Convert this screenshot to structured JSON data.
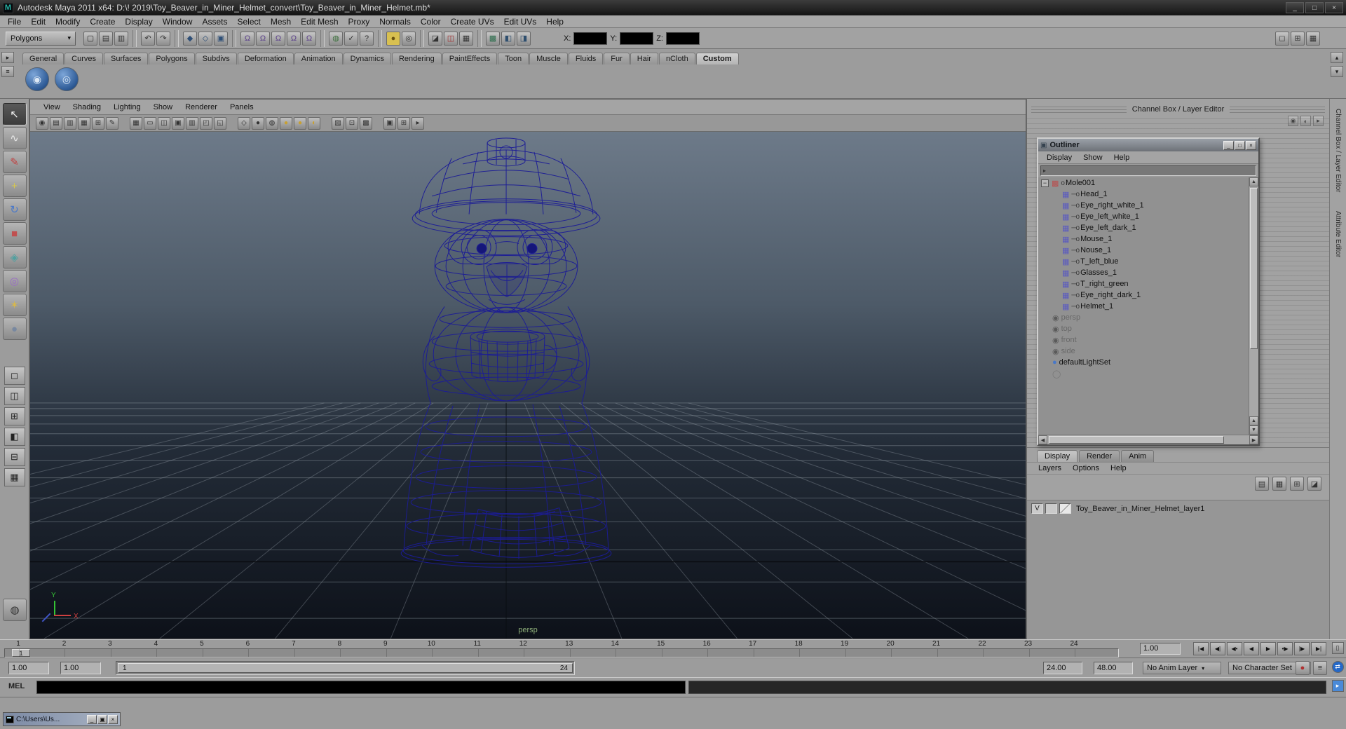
{
  "titlebar": {
    "icon_glyph": "M",
    "title": "Autodesk Maya 2011 x64: D:\\! 2019\\Toy_Beaver_in_Miner_Helmet_convert\\Toy_Beaver_in_Miner_Helmet.mb*",
    "buttons": [
      {
        "n": "minimize",
        "g": "_"
      },
      {
        "n": "maximize",
        "g": "□"
      },
      {
        "n": "close",
        "g": "×"
      }
    ]
  },
  "menubar": {
    "items": [
      "File",
      "Edit",
      "Modify",
      "Create",
      "Display",
      "Window",
      "Assets",
      "Select",
      "Mesh",
      "Edit Mesh",
      "Proxy",
      "Normals",
      "Color",
      "Create UVs",
      "Edit UVs",
      "Help"
    ]
  },
  "statusline": {
    "mode_dropdown": "Polygons",
    "icon_groups": [
      {
        "icons": [
          {
            "n": "new-scene",
            "g": "▢"
          },
          {
            "n": "open-scene",
            "g": "▤"
          },
          {
            "n": "save-scene",
            "g": "▥"
          }
        ]
      },
      {
        "icons": [
          {
            "n": "undo",
            "g": "↶"
          },
          {
            "n": "redo",
            "g": "↷"
          }
        ]
      },
      {
        "icons": [
          {
            "n": "select-hierarchy",
            "g": "◆",
            "c": "#2e4f77"
          },
          {
            "n": "select-object",
            "g": "◇",
            "c": "#2e4f77"
          },
          {
            "n": "select-component",
            "g": "▣",
            "c": "#2e4f77"
          }
        ]
      },
      {
        "icons": [
          {
            "n": "snap-to-grid",
            "g": "Ω",
            "c": "#5a3f8a"
          },
          {
            "n": "snap-to-curve",
            "g": "Ω",
            "c": "#5a3f8a"
          },
          {
            "n": "snap-to-point",
            "g": "Ω",
            "c": "#5a3f8a"
          },
          {
            "n": "snap-to-plane",
            "g": "Ω",
            "c": "#5a3f8a"
          },
          {
            "n": "snap-to-view",
            "g": "Ω",
            "c": "#5a3f8a"
          }
        ]
      },
      {
        "icons": [
          {
            "n": "make-live",
            "g": "◍",
            "c": "#3a6f3a"
          },
          {
            "n": "construction-history",
            "g": "✓",
            "c": "#333333"
          },
          {
            "n": "help-line",
            "g": "?",
            "c": "#333333"
          }
        ]
      },
      {
        "icons": [
          {
            "n": "lock-selection",
            "g": "●",
            "c": "#6a5210",
            "bg": "#d8c050"
          },
          {
            "n": "highlight-selection",
            "g": "◎",
            "c": "#333333"
          }
        ]
      },
      {
        "icons": [
          {
            "n": "render-view",
            "g": "◪",
            "c": "#333333"
          },
          {
            "n": "ipr-render",
            "g": "◫",
            "c": "#a03030"
          },
          {
            "n": "render-settings",
            "g": "▦",
            "c": "#333333"
          }
        ]
      },
      {
        "icons": [
          {
            "n": "texture-view",
            "g": "▩",
            "c": "#2e6e4e"
          },
          {
            "n": "hypershade",
            "g": "◧",
            "c": "#2e4e6e"
          },
          {
            "n": "hypergraph",
            "g": "◨",
            "c": "#2e4e6e"
          }
        ]
      }
    ],
    "coords": {
      "x_label": "X:",
      "y_label": "Y:",
      "z_label": "Z:",
      "x_value": "",
      "y_value": "",
      "z_value": ""
    },
    "layout_icons": [
      {
        "n": "single-pane-layout",
        "g": "◻"
      },
      {
        "n": "four-pane-layout",
        "g": "⊞"
      },
      {
        "n": "saved-layouts",
        "g": "▦"
      }
    ]
  },
  "shelf": {
    "tabs": [
      "General",
      "Curves",
      "Surfaces",
      "Polygons",
      "Subdivs",
      "Deformation",
      "Animation",
      "Dynamics",
      "Rendering",
      "PaintEffects",
      "Toon",
      "Muscle",
      "Fluids",
      "Fur",
      "Hair",
      "nCloth",
      "Custom"
    ],
    "active_tab": "Custom",
    "items": [
      {
        "n": "custom-shelf-item-1",
        "g": "◉"
      },
      {
        "n": "custom-shelf-item-2",
        "g": "◎"
      }
    ],
    "side_buttons": [
      {
        "n": "shelf-tab-menu",
        "g": "▸"
      },
      {
        "n": "shelf-options-menu",
        "g": "≡"
      }
    ],
    "right_buttons": [
      {
        "n": "shelf-scroll-up",
        "g": "▴"
      },
      {
        "n": "shelf-scroll-down",
        "g": "▾"
      }
    ]
  },
  "toolbox": {
    "tools": [
      {
        "n": "select-tool",
        "g": "↖",
        "c": "#f5f5f5",
        "active": true
      },
      {
        "n": "lasso-select-tool",
        "g": "∿",
        "c": "#e8e8e8"
      },
      {
        "n": "paint-select-tool",
        "g": "✎",
        "c": "#c04040"
      },
      {
        "n": "move-tool",
        "g": "+",
        "c": "#d8c84a"
      },
      {
        "n": "rotate-tool",
        "g": "↻",
        "c": "#4a78c8"
      },
      {
        "n": "scale-tool",
        "g": "■",
        "c": "#c05050"
      },
      {
        "n": "universal-manipulator-tool",
        "g": "◈",
        "c": "#50a0a0"
      },
      {
        "n": "soft-modification-tool",
        "g": "◎",
        "c": "#9a6ac8"
      },
      {
        "n": "show-manipulator-tool",
        "g": "✶",
        "c": "#d8b84a"
      },
      {
        "n": "last-tool",
        "g": "●",
        "c": "#7888a0"
      }
    ],
    "layouts": [
      {
        "n": "single-pane",
        "g": "◻"
      },
      {
        "n": "two-pane-side-by-side",
        "g": "◫"
      },
      {
        "n": "four-pane",
        "g": "⊞"
      },
      {
        "n": "three-pane-left",
        "g": "◧"
      },
      {
        "n": "two-pane-stacked",
        "g": "⊟"
      },
      {
        "n": "multi-pane",
        "g": "▦"
      }
    ],
    "extra": {
      "n": "toolbox-extra",
      "g": "◍"
    }
  },
  "viewport": {
    "menus": [
      "View",
      "Shading",
      "Lighting",
      "Show",
      "Renderer",
      "Panels"
    ],
    "toolbar": [
      {
        "n": "camera-select",
        "g": "◉"
      },
      {
        "n": "camera-attributes",
        "g": "▤"
      },
      {
        "n": "bookmarks",
        "g": "▥"
      },
      {
        "n": "image-plane",
        "g": "▦"
      },
      {
        "n": "2d-pan-zoom",
        "g": "⊞"
      },
      {
        "n": "grease-pencil",
        "g": "✎"
      },
      {
        "n": "gap"
      },
      {
        "n": "grid-toggle",
        "g": "▦"
      },
      {
        "n": "film-gate",
        "g": "▭"
      },
      {
        "n": "resolution-gate",
        "g": "◫"
      },
      {
        "n": "gate-mask",
        "g": "▣"
      },
      {
        "n": "field-chart",
        "g": "▥"
      },
      {
        "n": "safe-action",
        "g": "◰"
      },
      {
        "n": "safe-title",
        "g": "◱"
      },
      {
        "n": "gap"
      },
      {
        "n": "wireframe-display",
        "g": "◇"
      },
      {
        "n": "shaded-display",
        "g": "●"
      },
      {
        "n": "textured-display",
        "g": "◍"
      },
      {
        "n": "default-lighting",
        "g": "●",
        "c": "#c8a030"
      },
      {
        "n": "all-lights",
        "g": "●",
        "c": "#c8a030"
      },
      {
        "n": "shadows-toggle",
        "g": "◐",
        "c": "#c8a030"
      },
      {
        "n": "gap"
      },
      {
        "n": "xray-display",
        "g": "▨"
      },
      {
        "n": "isolate-select",
        "g": "⊡"
      },
      {
        "n": "multisample",
        "g": "▩"
      },
      {
        "n": "gap"
      },
      {
        "n": "tear-off-panel",
        "g": "▣"
      },
      {
        "n": "panel-config",
        "g": "⊞"
      },
      {
        "n": "share-view",
        "g": "▸"
      }
    ],
    "camera_label": "persp",
    "axis_y": "Y",
    "axis_x": "X"
  },
  "rightpanel": {
    "header": "Channel Box / Layer Editor",
    "top_icons": [
      {
        "n": "manipulator-sync",
        "g": "◉"
      },
      {
        "n": "speed-toggle",
        "g": "◐"
      },
      {
        "n": "channel-expand",
        "g": "▸"
      }
    ]
  },
  "outliner": {
    "title": "Outliner",
    "window_buttons": [
      {
        "n": "minimize",
        "g": "_"
      },
      {
        "n": "maximize",
        "g": "□"
      },
      {
        "n": "close",
        "g": "×"
      }
    ],
    "menus": [
      "Display",
      "Show",
      "Help"
    ],
    "icon_types": {
      "mesh": {
        "glyph": "▦",
        "color": "#5a5ac0"
      },
      "reference": {
        "glyph": "▩",
        "color": "#b85050"
      },
      "camera": {
        "glyph": "◉",
        "color": "#5a5a5a"
      },
      "lightset": {
        "glyph": "●",
        "color": "#4878c8"
      },
      "set": {
        "glyph": "◯",
        "color": "#777777"
      }
    },
    "items": [
      {
        "label": "Mole001",
        "icon": "reference",
        "expander": true,
        "connector": "o",
        "indent": 0
      },
      {
        "label": "Head_1",
        "icon": "mesh",
        "connector": "─o",
        "indent": 1
      },
      {
        "label": "Eye_right_white_1",
        "icon": "mesh",
        "connector": "─o",
        "indent": 1
      },
      {
        "label": "Eye_left_white_1",
        "icon": "mesh",
        "connector": "─o",
        "indent": 1
      },
      {
        "label": "Eye_left_dark_1",
        "icon": "mesh",
        "connector": "─o",
        "indent": 1
      },
      {
        "label": "Mouse_1",
        "icon": "mesh",
        "connector": "─o",
        "indent": 1
      },
      {
        "label": "Nouse_1",
        "icon": "mesh",
        "connector": "─o",
        "indent": 1
      },
      {
        "label": "T_left_blue",
        "icon": "mesh",
        "connector": "─o",
        "indent": 1
      },
      {
        "label": "Glasses_1",
        "icon": "mesh",
        "connector": "─o",
        "indent": 1
      },
      {
        "label": "T_right_green",
        "icon": "mesh",
        "connector": "─o",
        "indent": 1
      },
      {
        "label": "Eye_right_dark_1",
        "icon": "mesh",
        "connector": "─o",
        "indent": 1
      },
      {
        "label": "Helmet_1",
        "icon": "mesh",
        "connector": "─o",
        "indent": 1
      },
      {
        "label": "persp",
        "icon": "camera",
        "dimmed": true,
        "connector": "",
        "indent": 0
      },
      {
        "label": "top",
        "icon": "camera",
        "dimmed": true,
        "connector": "",
        "indent": 0
      },
      {
        "label": "front",
        "icon": "camera",
        "dimmed": true,
        "connector": "",
        "indent": 0
      },
      {
        "label": "side",
        "icon": "camera",
        "dimmed": true,
        "connector": "",
        "indent": 0
      },
      {
        "label": "defaultLightSet",
        "icon": "lightset",
        "connector": "",
        "indent": 0
      },
      {
        "label": "",
        "icon": "set",
        "connector": "",
        "indent": 0
      }
    ]
  },
  "layer_editor": {
    "tabs": [
      "Display",
      "Render",
      "Anim"
    ],
    "active_tab": "Display",
    "menus": [
      "Layers",
      "Options",
      "Help"
    ],
    "icons": [
      {
        "n": "new-empty-layer",
        "g": "▤"
      },
      {
        "n": "new-layer-assign-selected",
        "g": "▦"
      },
      {
        "n": "move-layer-up",
        "g": "⊞"
      },
      {
        "n": "layer-options",
        "g": "◪"
      }
    ],
    "layers": [
      {
        "visibility": "V",
        "name": "Toy_Beaver_in_Miner_Helmet_layer1"
      }
    ]
  },
  "timeline": {
    "ticks": [
      "1",
      "2",
      "3",
      "4",
      "5",
      "6",
      "7",
      "8",
      "9",
      "10",
      "11",
      "12",
      "13",
      "14",
      "15",
      "16",
      "17",
      "18",
      "19",
      "20",
      "21",
      "22",
      "23",
      "24"
    ],
    "current_frame": "1",
    "current_time": "1.00",
    "playback": [
      {
        "n": "go-to-start",
        "g": "|◀"
      },
      {
        "n": "step-back-frame",
        "g": "◀|"
      },
      {
        "n": "step-back-key",
        "g": "◀•"
      },
      {
        "n": "play-backwards",
        "g": "◀"
      },
      {
        "n": "play-forwards",
        "g": "▶"
      },
      {
        "n": "step-forward-key",
        "g": "•▶"
      },
      {
        "n": "step-forward-frame",
        "g": "|▶"
      },
      {
        "n": "go-to-end",
        "g": "▶|"
      }
    ]
  },
  "range_slider": {
    "anim_start": "1.00",
    "playback_start": "1.00",
    "range_start": "1",
    "range_end": "24",
    "playback_end": "24.00",
    "anim_end": "48.00",
    "anim_layer": "No Anim Layer",
    "character_set": "No Character Set",
    "icons": [
      {
        "n": "auto-keyframe",
        "g": "●",
        "c": "#b03030"
      },
      {
        "n": "animation-preferences",
        "g": "≡"
      }
    ]
  },
  "commandline": {
    "label": "MEL"
  },
  "taskbar": {
    "window_title": "C:\\Users\\Us...",
    "buttons": [
      {
        "n": "minimize",
        "g": "_"
      },
      {
        "n": "restore",
        "g": "▣"
      },
      {
        "n": "close",
        "g": "×"
      }
    ]
  },
  "sidetabs": {
    "channel_box": "Channel Box / Layer Editor",
    "attribute_editor": "Attribute Editor"
  },
  "corner_icons": [
    {
      "n": "remote-monitor",
      "g": "▯"
    },
    {
      "n": "teamviewer",
      "g": "⇄",
      "bg": "#2468c8",
      "c": "#ffffff",
      "round": true
    },
    {
      "n": "notification",
      "g": "▸",
      "bg": "#4a8ad8",
      "c": "#ffffff"
    }
  ]
}
